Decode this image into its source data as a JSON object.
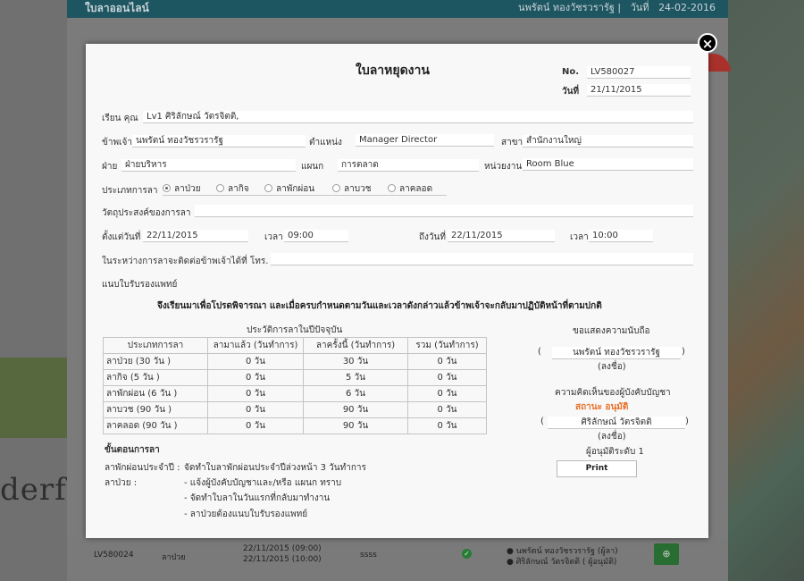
{
  "background": {
    "app_title": "ใบลาออนไลน์",
    "header_user": "นพรัตน์ ทองวัชรวรารัฐ |",
    "header_date_label": "วันที่",
    "header_date": "24-02-2016",
    "watermark_text": "derfu",
    "row": {
      "doc_no": "LV580024",
      "type": "ลาป่วย",
      "dates": [
        "22/11/2015 (09:00)",
        "22/11/2015 (10:00)"
      ],
      "reason": "ssss",
      "approvers": [
        "นพรัตน์ ทองวัชรวรารัฐ (ผู้ลา)",
        "ศิริลักษณ์ วัตรจิตติ ( ผู้อนุมัติ)"
      ]
    },
    "circle_colors": [
      "#3c8a7c",
      "#3f8a40",
      "#5b8a3a",
      "#2d6e45",
      "#b05a25",
      "#3a7a80",
      "#3a7a6a",
      "#4a6a8a",
      "#5a8a55",
      "#a9312b"
    ]
  },
  "modal": {
    "title": "ใบลาหยุดงาน",
    "no_label": "No.",
    "no_value": "LV580027",
    "date_label": "วันที่",
    "date_value": "21/11/2015",
    "to_label": "เรียน คุณ",
    "to_value": "Lv1 ศิริลักษณ์ วัตรจิตติ,",
    "name_label": "ข้าพเจ้า",
    "name_value": "นพรัตน์ ทองวัชรวรารัฐ",
    "position_label": "ตำแหน่ง",
    "position_value": "Manager Director",
    "branch_label": "สาขา",
    "branch_value": "สำนักงานใหญ่",
    "division_label": "ฝ่าย",
    "division_value": "ฝ่ายบริหาร",
    "dept_label": "แผนก",
    "dept_value": "การตลาด",
    "unit_label": "หน่วยงาน",
    "unit_value": "Room Blue",
    "leave_type_label": "ประเภทการลา",
    "leave_types": [
      {
        "label": "ลาป่วย",
        "selected": true
      },
      {
        "label": "ลากิจ",
        "selected": false
      },
      {
        "label": "ลาพักผ่อน",
        "selected": false
      },
      {
        "label": "ลาบวช",
        "selected": false
      },
      {
        "label": "ลาคลอด",
        "selected": false
      }
    ],
    "purpose_label": "วัตถุประสงค์ของการลา",
    "purpose_value": "",
    "from_label": "ตั้งแต่วันที่",
    "from_date": "22/11/2015",
    "from_time_label": "เวลา",
    "from_time": "09:00",
    "to_date_label": "ถึงวันที่",
    "to_date": "22/11/2015",
    "to_time_label": "เวลา",
    "to_time": "10:00",
    "contact_label": "ในระหว่างการลาจะติดต่อข้าพเจ้าได้ที่ โทร.",
    "contact_value": "",
    "medcert_label": "แนบใบรับรองแพทย์",
    "statement": "จึงเรียนมาเพื่อโปรดพิจารณา และเมื่อครบกำหนดตามวันและเวลาดังกล่าวแล้วข้าพเจ้าจะกลับมาปฏิบัติหน้าที่ตามปกติ",
    "history_caption": "ประวัติการลาในปีปัจจุบัน",
    "history_headers": [
      "ประเภทการลา",
      "ลามาแล้ว (วันทำการ)",
      "ลาครั้งนี้ (วันทำการ)",
      "รวม (วันทำการ)"
    ],
    "history_rows": [
      [
        "ลาป่วย (30 วัน )",
        "0 วัน",
        "30 วัน",
        "0 วัน"
      ],
      [
        "ลากิจ (5 วัน )",
        "0 วัน",
        "5 วัน",
        "0 วัน"
      ],
      [
        "ลาพักผ่อน (6 วัน )",
        "0 วัน",
        "6 วัน",
        "0 วัน"
      ],
      [
        "ลาบวช (90 วัน )",
        "0 วัน",
        "90 วัน",
        "0 วัน"
      ],
      [
        "ลาคลอด (90 วัน )",
        "0 วัน",
        "90 วัน",
        "0 วัน"
      ]
    ],
    "procedure_title": "ขั้นตอนการลา",
    "procedure_vacation_label": "ลาพักผ่อนประจำปี :",
    "procedure_vacation_text": "จัดทำใบลาพักผ่อนประจำปีล่วงหน้า 3 วันทำการ",
    "procedure_sick_label": "ลาป่วย :",
    "procedure_sick_items": [
      "- แจ้งผู้บังคับบัญชาและ/หรือ แผนก ทราบ",
      "- จัดทำใบลาในวันแรกที่กลับมาทำงาน",
      "- ลาป่วยต้องแนบใบรับรองแพทย์"
    ],
    "respect_label": "ขอแสดงความนับถือ",
    "open_paren": "(",
    "close_paren": ")",
    "requester_sig": "นพรัตน์ ทองวัชรวรารัฐ",
    "sign_label": "(ลงชื่อ)",
    "supervisor_label": "ความคิดเห็นของผู้บังคับบัญชา",
    "status_text": "สถานะ อนุมัติ",
    "approver_sig": "ศิริลักษณ์ วัตรจิตติ",
    "approver_sign_label": "(ลงชื่อ)",
    "approver_level": "ผู้อนุมัติระดับ 1",
    "print_label": "Print",
    "close_icon": "×"
  },
  "colors": {
    "header_bg": "#1d5561",
    "status_orange": "#e8702a",
    "approve_button": "#286d32"
  }
}
